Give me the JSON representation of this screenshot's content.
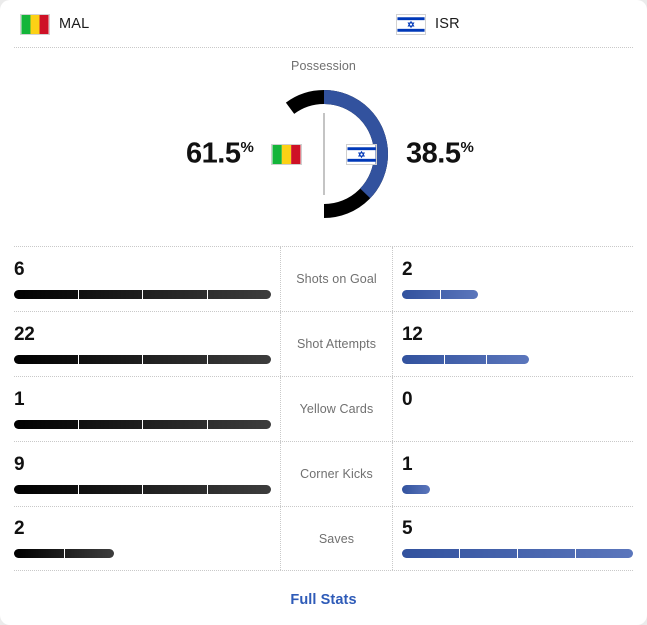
{
  "header": {
    "home": {
      "abbr": "MAL",
      "flag": "mali-flag"
    },
    "away": {
      "abbr": "ISR",
      "flag": "israel-flag"
    }
  },
  "possession": {
    "title": "Possession",
    "home_pct": "61.5",
    "away_pct": "38.5",
    "pct_symbol": "%",
    "home_flag": "mali-flag",
    "away_flag": "israel-flag"
  },
  "colors": {
    "home_bar_start": "#000000",
    "home_bar_end": "#3d3d3d",
    "away_bar_start": "#32529e",
    "away_bar_end": "#5b76bc",
    "link": "#2e5bb8",
    "label": "#707070",
    "donut_home": "#000000",
    "donut_away": "#32529e"
  },
  "chart_data": {
    "type": "pie",
    "title": "Possession",
    "categories": [
      "MAL",
      "ISR"
    ],
    "values": [
      61.5,
      38.5
    ],
    "unit": "%",
    "colors": [
      "#000000",
      "#32529e"
    ],
    "legend": "flags-in-center"
  },
  "stats": {
    "rows": [
      {
        "label": "Shots on Goal",
        "home": "6",
        "away": "2",
        "home_pct": 100,
        "away_pct": 33,
        "home_segs": 4,
        "away_segs": 2
      },
      {
        "label": "Shot Attempts",
        "home": "22",
        "away": "12",
        "home_pct": 100,
        "away_pct": 55,
        "home_segs": 4,
        "away_segs": 3
      },
      {
        "label": "Yellow Cards",
        "home": "1",
        "away": "0",
        "home_pct": 100,
        "away_pct": 0,
        "home_segs": 4,
        "away_segs": 0
      },
      {
        "label": "Corner Kicks",
        "home": "9",
        "away": "1",
        "home_pct": 100,
        "away_pct": 12,
        "home_segs": 4,
        "away_segs": 1
      },
      {
        "label": "Saves",
        "home": "2",
        "away": "5",
        "home_pct": 39,
        "away_pct": 100,
        "home_segs": 2,
        "away_segs": 4
      }
    ]
  },
  "footer": {
    "full_stats_label": "Full Stats"
  }
}
